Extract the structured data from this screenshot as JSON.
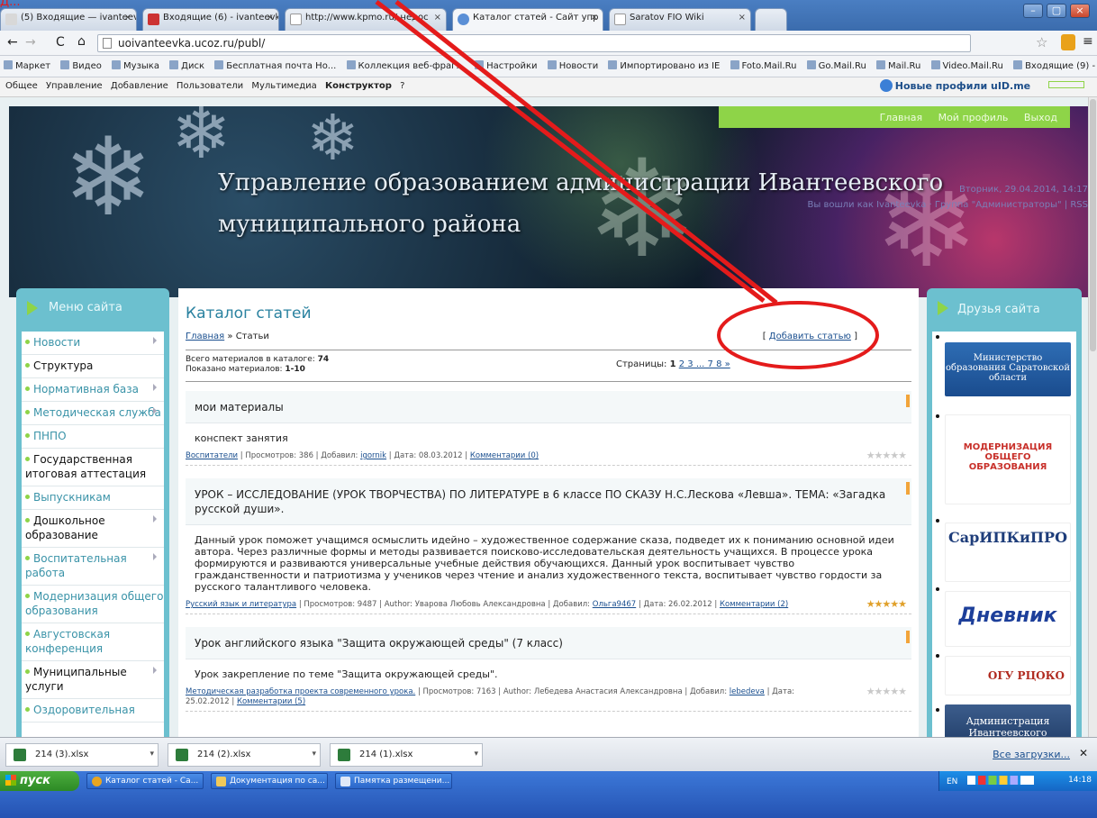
{
  "browser": {
    "tabs": [
      {
        "label": "(5) Входящие — ivanteevka"
      },
      {
        "label": "Входящие (6) - ivanteevkan"
      },
      {
        "label": "http://www.kpmo.ru/ недос"
      },
      {
        "label": "Каталог статей - Сайт упр"
      },
      {
        "label": "Saratov FIO Wiki"
      }
    ],
    "url": "uoivanteevka.ucoz.ru/publ/",
    "bookmarks": [
      "Маркет",
      "Видео",
      "Музыка",
      "Диск",
      "Бесплатная почта Но...",
      "Коллекция веб-фраг...",
      "Настройки",
      "Новости",
      "Импортировано из IE",
      "Foto.Mail.Ru",
      "Go.Mail.Ru",
      "Mail.Ru",
      "Video.Mail.Ru",
      "Входящие (9) - ivant..."
    ]
  },
  "ucoz_bar": {
    "items": [
      "Общее",
      "Управление",
      "Добавление",
      "Пользователи",
      "Мультимедиа"
    ],
    "active": "Конструктор",
    "help": "?",
    "right_link": "Новые профили uID.me"
  },
  "site": {
    "title_line1": "Управление образованием администрации   Ивантеевского",
    "title_line2": "муниципального района",
    "nav": [
      "Главная",
      "Мой профиль",
      "Выход"
    ],
    "user_date": "Вторник, 29.04.2014, 14:17",
    "user_line": "Вы вошли как Ivanteevka · Группа \"Администраторы\" | RSS"
  },
  "menu": {
    "title": "Меню сайта",
    "items": [
      {
        "label": "Новости"
      },
      {
        "label": "Структура"
      },
      {
        "label": "Нормативная база"
      },
      {
        "label": "Методическая служба"
      },
      {
        "label": "ПНПО"
      },
      {
        "label": "Государственная итоговая аттестация"
      },
      {
        "label": "Выпускникам"
      },
      {
        "label": "Дошкольное образование"
      },
      {
        "label": "Воспитательная работа"
      },
      {
        "label": "Модернизация общего образования"
      },
      {
        "label": "Августовская конференция"
      },
      {
        "label": "Муниципальные услуги"
      },
      {
        "label": "Оздоровительная"
      }
    ]
  },
  "main": {
    "title": "Каталог статей",
    "breadcrumb_home": "Главная",
    "breadcrumb_sep": " » ",
    "breadcrumb_current": "Статьи",
    "add_open": "[ ",
    "add_link": "Добавить статью",
    "add_close": " ]",
    "total_label": "Всего материалов в каталоге: ",
    "total_value": "74",
    "shown_label": "Показано материалов: ",
    "shown_value": "1-10",
    "pages_label": "Страницы: ",
    "pages_current": "1",
    "pages_links": "2 3 ... 7 8 »",
    "entries": [
      {
        "title": "мои материалы",
        "body": "конспект занятия",
        "category": "Воспитатели",
        "meta": " | Просмотров: 386 | Добавил: ",
        "author": "igornik",
        "meta2": " | Дата: 08.03.2012 | ",
        "comments": "Комментарии (0)",
        "stars": "★★★★★"
      },
      {
        "title": "УРОК – ИССЛЕДОВАНИЕ (УРОК ТВОРЧЕСТВА) ПО ЛИТЕРАТУРЕ в 6 классе ПО СКАЗУ Н.С.Лескова «Левша». ТЕМА: «Загадка русской души».",
        "body": "Данный урок поможет учащимся осмыслить идейно – художественное содержание сказа, подведет их к пониманию основной идеи автора. Через различные формы и методы развивается поисково-исследовательская деятельность учащихся. В процессе урока формируются и развиваются универсальные учебные действия обучающихся. Данный урок воспитывает чувство гражданственности и патриотизма у учеников через чтение и анализ художественного текста, воспитывает чувство гордости за русского талантливого человека.",
        "category": "Русский язык и литература",
        "meta": " | Просмотров: 9487 | Author: Уварова Любовь Александровна | Добавил: ",
        "author": "Ольга9467",
        "meta2": " | Дата: 26.02.2012 | ",
        "comments": "Комментарии (2)",
        "stars": "★★★★★"
      },
      {
        "title": "Урок английского языка \"Защита окружающей среды\" (7 класс)",
        "body": "Урок закрепление по теме \"Защита окружающей среды\".",
        "category": "Методическая разработка проекта современного урока.",
        "meta": " | Просмотров: 7163 | Author: Лебедева Анастасия Александровна | Добавил: ",
        "author": "lebedeva",
        "meta2": " | Дата: 25.02.2012 | ",
        "comments": "Комментарии (5)",
        "stars": "★★★★★"
      }
    ]
  },
  "friends": {
    "title": "Друзья сайта",
    "items": [
      {
        "label": "Министерство образования Саратовской области"
      },
      {
        "label": "МОДЕРНИЗАЦИЯ ОБЩЕГО ОБРАЗОВАНИЯ"
      },
      {
        "label": "СарИПКиПРО"
      },
      {
        "label": "Дневник"
      },
      {
        "label": "ОГУ РЦОКО"
      },
      {
        "label": "Администрация Ивантеевского"
      }
    ]
  },
  "downloads": {
    "items": [
      "214 (3).xlsx",
      "214 (2).xlsx",
      "214 (1).xlsx"
    ],
    "all_label": "Все загрузки..."
  },
  "taskbar": {
    "start": "пуск",
    "items": [
      "Каталог статей - Са...",
      "Документация по са...",
      "Памятка размещени..."
    ],
    "lang": "EN",
    "clock": "14:18"
  },
  "annotation": {
    "text": "Д..."
  },
  "colors": {
    "accent": "#6cc0cf",
    "green": "#8ed448",
    "red_annotation": "#e41b1b",
    "link": "#1a4f8f"
  }
}
